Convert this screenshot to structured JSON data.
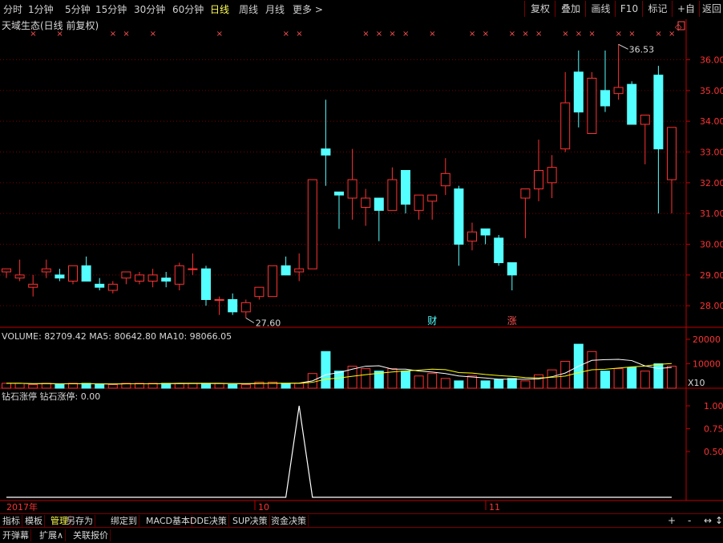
{
  "toolbar": {
    "tabs": [
      "分时",
      "1分钟",
      "5分钟",
      "15分钟",
      "30分钟",
      "60分钟",
      "日线",
      "周线",
      "月线",
      "更多 >"
    ],
    "active_tab": "日线",
    "right_buttons": [
      "复权",
      "叠加",
      "画线",
      "F10",
      "标记",
      "+自选",
      "返回"
    ]
  },
  "main_panel": {
    "title": "天域生态(日线 前复权)",
    "high_label": "36.53",
    "low_label": "27.60",
    "event_labels": [
      "财",
      "涨"
    ],
    "x_marker": "×",
    "diamond": "◇"
  },
  "volume_panel": {
    "legend": "VOLUME: 82709.42  MA5: 80642.80  MA10: 98066.05",
    "unit": "X10"
  },
  "indicator_panel": {
    "legend": "钻石涨停  钻石涨停: 0.00"
  },
  "time_axis": [
    "2017年",
    "10",
    "11"
  ],
  "bottom_tabs": [
    "指标",
    "模板",
    "管理",
    "另存为",
    "绑定到",
    "MACD基本",
    "DDE决策",
    "SUP决策",
    "资金决策"
  ],
  "bottom_active": "管理",
  "bottom_controls": [
    "+",
    "-",
    "↔",
    "↕"
  ],
  "bottom_row2": [
    "开弹幕",
    "扩展∧",
    "关联报价"
  ],
  "colors": {
    "up": "#ff3232",
    "down": "#54ffff",
    "axis": "#c00000",
    "ma": "#ffffff",
    "ma2": "#ffff00"
  },
  "chart_data": [
    {
      "type": "candlestick",
      "title": "天域生态(日线 前复权)",
      "y_ticks": [
        "28.00",
        "29.00",
        "30.00",
        "31.00",
        "32.00",
        "33.00",
        "34.00",
        "35.00",
        "36.00"
      ],
      "ylim": [
        27.3,
        36.9
      ],
      "ohlc": [
        [
          29.1,
          29.2,
          28.9,
          29.2
        ],
        [
          28.9,
          29.5,
          28.8,
          29.0
        ],
        [
          28.6,
          29.0,
          28.3,
          28.7
        ],
        [
          29.1,
          29.5,
          28.9,
          29.2
        ],
        [
          29.0,
          29.2,
          28.8,
          28.9
        ],
        [
          28.8,
          29.3,
          28.7,
          29.3
        ],
        [
          29.3,
          29.6,
          29.0,
          28.8
        ],
        [
          28.7,
          28.9,
          28.5,
          28.6
        ],
        [
          28.5,
          28.8,
          28.4,
          28.7
        ],
        [
          28.9,
          29.1,
          28.7,
          29.1
        ],
        [
          28.8,
          29.1,
          28.7,
          29.0
        ],
        [
          28.8,
          29.2,
          28.6,
          29.0
        ],
        [
          28.9,
          29.1,
          28.6,
          28.8
        ],
        [
          28.7,
          29.4,
          28.5,
          29.3
        ],
        [
          29.2,
          29.7,
          29.0,
          29.2
        ],
        [
          29.2,
          29.3,
          28.0,
          28.2
        ],
        [
          28.2,
          28.3,
          27.7,
          28.2
        ],
        [
          28.2,
          28.4,
          27.7,
          27.8
        ],
        [
          27.8,
          28.2,
          27.6,
          28.1
        ],
        [
          28.3,
          28.6,
          28.2,
          28.6
        ],
        [
          28.3,
          29.3,
          28.3,
          29.3
        ],
        [
          29.3,
          29.6,
          29.0,
          29.0
        ],
        [
          29.1,
          29.7,
          28.8,
          29.2
        ],
        [
          29.2,
          32.1,
          29.2,
          32.1
        ],
        [
          33.1,
          34.7,
          31.9,
          32.9
        ],
        [
          31.7,
          31.6,
          30.5,
          31.6
        ],
        [
          31.5,
          33.1,
          30.8,
          32.1
        ],
        [
          31.2,
          31.8,
          30.6,
          31.5
        ],
        [
          31.5,
          31.5,
          30.1,
          31.1
        ],
        [
          31.1,
          32.5,
          31.1,
          32.1
        ],
        [
          32.4,
          32.4,
          31.0,
          31.3
        ],
        [
          31.1,
          31.6,
          30.8,
          31.6
        ],
        [
          31.4,
          31.6,
          30.8,
          31.6
        ],
        [
          31.9,
          32.8,
          31.6,
          32.3
        ],
        [
          31.8,
          31.9,
          29.3,
          30.0
        ],
        [
          30.1,
          30.7,
          29.8,
          30.4
        ],
        [
          30.5,
          30.5,
          30.0,
          30.3
        ],
        [
          30.2,
          30.3,
          29.3,
          29.4
        ],
        [
          29.4,
          29.4,
          28.5,
          29.0
        ],
        [
          31.5,
          31.8,
          30.2,
          31.8
        ],
        [
          31.8,
          33.4,
          31.4,
          32.4
        ],
        [
          32.0,
          32.9,
          31.5,
          32.5
        ],
        [
          33.1,
          35.6,
          33.0,
          34.6
        ],
        [
          35.6,
          36.3,
          33.8,
          34.3
        ],
        [
          33.6,
          35.6,
          33.6,
          35.4
        ],
        [
          35.0,
          36.3,
          34.3,
          34.5
        ],
        [
          34.9,
          36.5,
          34.7,
          35.1
        ],
        [
          35.2,
          35.3,
          33.9,
          33.9
        ],
        [
          33.9,
          34.2,
          32.6,
          34.2
        ],
        [
          35.5,
          35.8,
          31.0,
          33.1
        ],
        [
          32.1,
          33.8,
          31.0,
          33.8
        ]
      ],
      "volume_ticks": [
        "10000",
        "20000"
      ],
      "volume": [
        2,
        2,
        1.5,
        2,
        1.5,
        2,
        2,
        1.5,
        1.5,
        2,
        2,
        2,
        2,
        2,
        2,
        2,
        2,
        1.5,
        1.5,
        2.5,
        2.5,
        2,
        2,
        6,
        15,
        7,
        9,
        8,
        7,
        8,
        7,
        5,
        6,
        4,
        3,
        5,
        3,
        3.5,
        4,
        3,
        5.5,
        7.5,
        11,
        18,
        15,
        7,
        8,
        8.5,
        7,
        10,
        9
      ],
      "indicator_ticks": [
        "0.50",
        "0.75",
        "1.00"
      ],
      "indicator_name": "钻石涨停",
      "indicator": [
        0,
        0,
        0,
        0,
        0,
        0,
        0,
        0,
        0,
        0,
        0,
        0,
        0,
        0,
        0,
        0,
        0,
        0,
        0,
        0,
        0,
        0,
        1,
        0,
        0,
        0,
        0,
        0,
        0,
        0,
        0,
        0,
        0,
        0,
        0,
        0,
        0,
        0,
        0,
        0,
        0,
        0,
        0,
        0,
        0,
        0,
        0,
        0,
        0,
        0,
        0
      ]
    }
  ]
}
